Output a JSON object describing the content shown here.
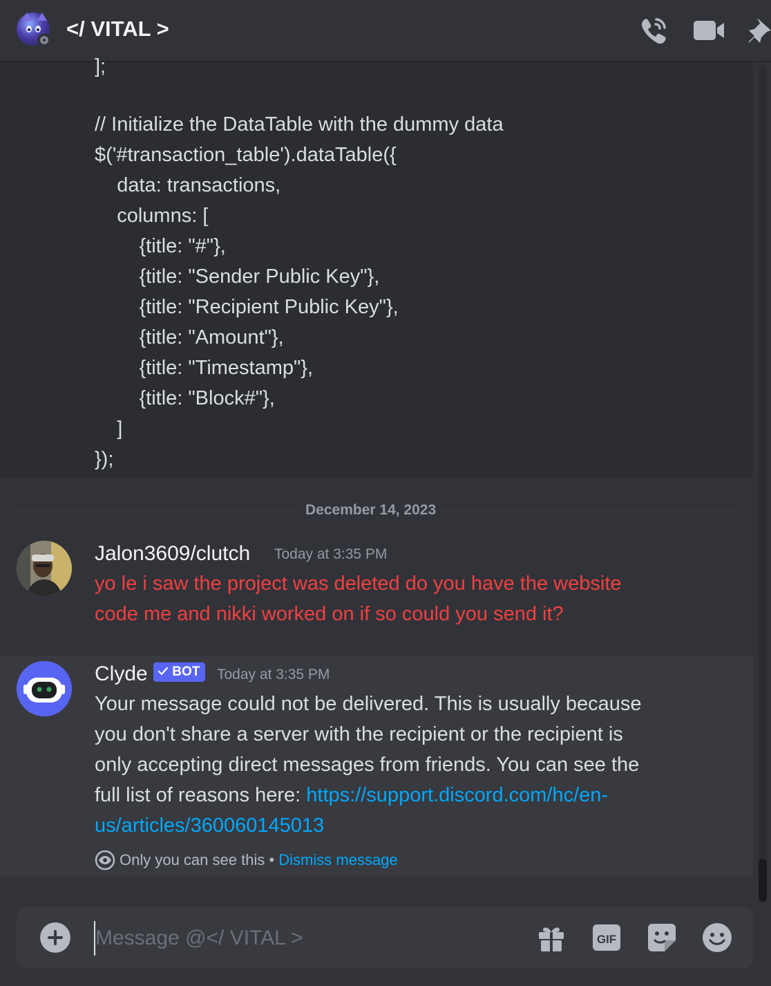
{
  "header": {
    "title": "</ VITAL >"
  },
  "code_lines": [
    "];",
    "",
    "// Initialize the DataTable with the dummy data",
    "$('#transaction_table').dataTable({",
    "    data: transactions,",
    "    columns: [",
    "        {title: \"#\"},",
    "        {title: \"Sender Public Key\"},",
    "        {title: \"Recipient Public Key\"},",
    "        {title: \"Amount\"},",
    "        {title: \"Timestamp\"},",
    "        {title: \"Block#\"},",
    "    ]",
    "});"
  ],
  "date_divider": "December 14, 2023",
  "messages": [
    {
      "username": "Jalon3609/clutch",
      "timestamp": "Today at 3:35 PM",
      "text_line1": "yo le i saw the project was deleted do you have the website",
      "text_line2": "code me and nikki worked on if so could you send it?",
      "text_color": "#f23f42"
    },
    {
      "username": "Clyde",
      "badge": "BOT",
      "timestamp": "Today at 3:35 PM",
      "text_line1": "Your message could not be delivered. This is usually because",
      "text_line2": "you don't share a server with the recipient or the recipient is",
      "text_line3": "only accepting direct messages from friends. You can see the",
      "text_line4_prefix": "full list of reasons here: ",
      "link_line1": "https://support.discord.com/hc/en-",
      "link_line2": "us/articles/360060145013",
      "ephemeral_note": "Only you can see this",
      "separator": " • ",
      "dismiss_label": "Dismiss message"
    }
  ],
  "composer": {
    "placeholder": "Message @</ VITAL >"
  },
  "icons": {
    "header": [
      "phone-call-icon",
      "video-camera-icon",
      "pin-icon"
    ],
    "composer": [
      "add-attachment-icon",
      "gift-icon",
      "gif-icon",
      "sticker-icon",
      "emoji-icon"
    ]
  },
  "colors": {
    "background": "#313338",
    "code_background": "#2b2d31",
    "clyde_highlight": "#383a40",
    "link": "#00a8fc",
    "bot_badge": "#5865f2",
    "error_text": "#f23f42"
  }
}
